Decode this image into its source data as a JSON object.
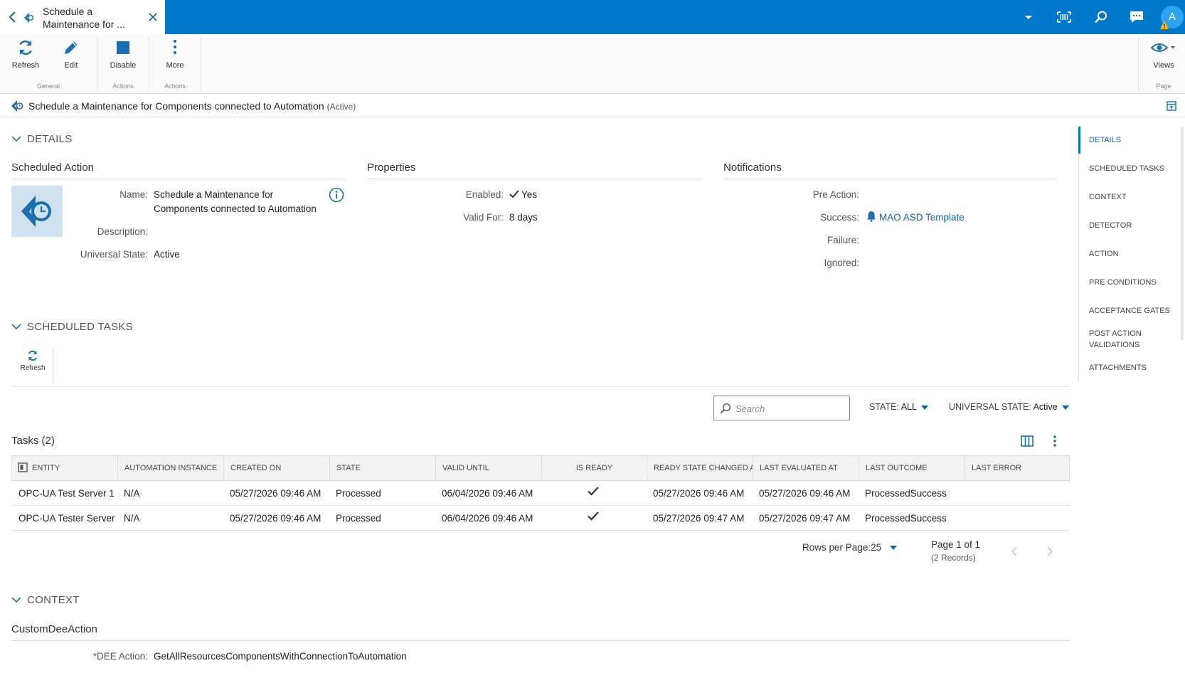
{
  "tab": {
    "title": "Schedule a\nMaintenance for ..."
  },
  "ribbon": {
    "buttons": [
      {
        "label": "Refresh",
        "icon": "refresh-icon"
      },
      {
        "label": "Edit",
        "icon": "pencil-icon"
      },
      {
        "label": "Disable",
        "icon": "stop-square-icon"
      },
      {
        "label": "More",
        "icon": "more-vertical-icon"
      }
    ],
    "groups": [
      "General",
      "Actions",
      "Actions"
    ],
    "views_label": "Views",
    "page_group": "Page"
  },
  "user": {
    "initial": "A"
  },
  "header": {
    "title": "Schedule a Maintenance for Components connected to Automation",
    "state": "(Active)"
  },
  "details": {
    "section_label": "DETAILS",
    "scheduled_action": {
      "title": "Scheduled Action",
      "name_label": "Name:",
      "name_value": "Schedule a Maintenance for\nComponents connected to Automation",
      "description_label": "Description:",
      "description_value": "",
      "universal_state_label": "Universal State:",
      "universal_state_value": "Active"
    },
    "properties": {
      "title": "Properties",
      "enabled_label": "Enabled:",
      "enabled_value": "Yes",
      "valid_for_label": "Valid For:",
      "valid_for_value": "8 days"
    },
    "notifications": {
      "title": "Notifications",
      "pre_action_label": "Pre Action:",
      "success_label": "Success:",
      "success_value": "MAO ASD Template",
      "failure_label": "Failure:",
      "ignored_label": "Ignored:"
    }
  },
  "right_nav": {
    "items": [
      "DETAILS",
      "SCHEDULED TASKS",
      "CONTEXT",
      "DETECTOR",
      "ACTION",
      "PRE CONDITIONS",
      "ACCEPTANCE GATES",
      "POST ACTION\nVALIDATIONS",
      "ATTACHMENTS"
    ],
    "active_index": 0
  },
  "scheduled_tasks": {
    "section_label": "SCHEDULED TASKS",
    "refresh_label": "Refresh",
    "search_placeholder": "Search",
    "state_filter_label": "STATE:",
    "state_filter_value": "ALL",
    "universal_state_filter_label": "UNIVERSAL STATE:",
    "universal_state_filter_value": "Active",
    "tasks_title": "Tasks (2)",
    "columns": [
      "ENTITY",
      "AUTOMATION INSTANCE",
      "CREATED ON",
      "STATE",
      "VALID UNTIL",
      "IS READY",
      "READY STATE CHANGED AT",
      "LAST EVALUATED AT",
      "LAST OUTCOME",
      "LAST ERROR"
    ],
    "rows": [
      {
        "entity": "OPC-UA Test Server 1",
        "automation_instance": "N/A",
        "created_on": "05/27/2026 09:46 AM",
        "state": "Processed",
        "valid_until": "06/04/2026 09:46 AM",
        "ready_state_changed_at": "05/27/2026 09:46 AM",
        "last_evaluated_at": "05/27/2026 09:46 AM",
        "last_outcome": "ProcessedSuccess",
        "last_error": ""
      },
      {
        "entity": "OPC-UA Tester Server",
        "automation_instance": "N/A",
        "created_on": "05/27/2026 09:46 AM",
        "state": "Processed",
        "valid_until": "06/04/2026 09:46 AM",
        "ready_state_changed_at": "05/27/2026 09:47 AM",
        "last_evaluated_at": "05/27/2026 09:47 AM",
        "last_outcome": "ProcessedSuccess",
        "last_error": ""
      }
    ],
    "rows_per_page_label": "Rows per Page:",
    "rows_per_page_value": "25",
    "page_label": "Page 1 of 1",
    "records_label": "(2 Records)"
  },
  "context": {
    "section_label": "CONTEXT",
    "subtitle": "CustomDeeAction",
    "required_marker": "*",
    "dee_action_label": "DEE Action:",
    "dee_action_value": "GetAllResourcesComponentsWithConnectionToAutomation"
  },
  "colors": {
    "brand_blue": "#0078c9",
    "link_blue": "#0a63b5",
    "avatar_blue": "#2ea3f2",
    "required_red": "#c0392b"
  }
}
